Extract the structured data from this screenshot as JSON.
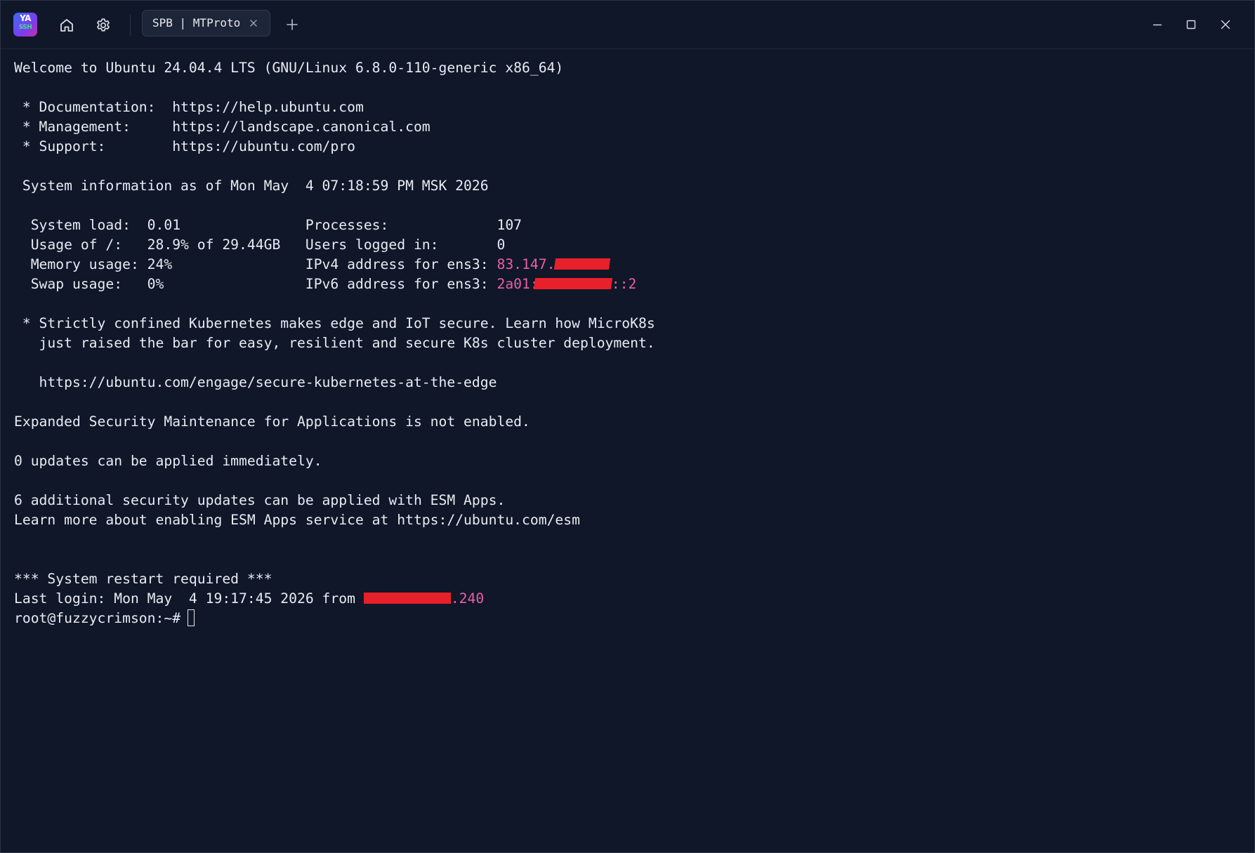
{
  "app": {
    "logo_text": "YA",
    "logo_sub": "SSH",
    "home_icon": "home-icon",
    "settings_icon": "gear-icon"
  },
  "tabs": [
    {
      "label": "SPB | MTProto",
      "active": true
    }
  ],
  "colors": {
    "background": "#0f1729",
    "tab_background": "#1d2638",
    "text": "#e8ebf2",
    "accent": "#ec5fa6",
    "redaction": "#e8202a"
  },
  "terminal": {
    "welcome": "Welcome to Ubuntu 24.04.4 LTS (GNU/Linux 6.8.0-110-generic x86_64)",
    "doc_line": " * Documentation:  https://help.ubuntu.com",
    "mgmt_line": " * Management:     https://landscape.canonical.com",
    "support_line": " * Support:        https://ubuntu.com/pro",
    "sysinfo_line": " System information as of Mon May  4 07:18:59 PM MSK 2026",
    "sysload_line": "  System load:  0.01               Processes:             107",
    "usage_line": "  Usage of /:   28.9% of 29.44GB   Users logged in:       0",
    "memory_prefix": "  Memory usage: 24%                IPv4 address for ens3: ",
    "ipv4_visible": "83.147.",
    "swap_prefix": "  Swap usage:   0%                 IPv6 address for ens3: ",
    "ipv6_visible_start": "2a01:",
    "ipv6_visible_end": "::2",
    "k8s_line1": " * Strictly confined Kubernetes makes edge and IoT secure. Learn how MicroK8s",
    "k8s_line2": "   just raised the bar for easy, resilient and secure K8s cluster deployment.",
    "k8s_url": "   https://ubuntu.com/engage/secure-kubernetes-at-the-edge",
    "esm_line": "Expanded Security Maintenance for Applications is not enabled.",
    "updates_line": "0 updates can be applied immediately.",
    "security_updates_line": "6 additional security updates can be applied with ESM Apps.",
    "learn_more_line": "Learn more about enabling ESM Apps service at https://ubuntu.com/esm",
    "restart_line": "*** System restart required ***",
    "last_login_prefix": "Last login: Mon May  4 19:17:45 2026 from ",
    "last_login_visible": ".240",
    "prompt": "root@fuzzycrimson:~#"
  }
}
